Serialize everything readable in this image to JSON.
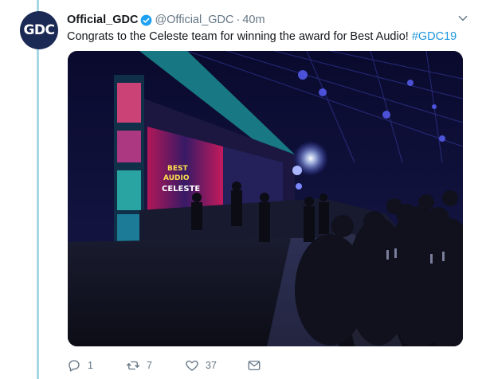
{
  "tweet": {
    "author_name": "Official_GDC",
    "handle": "@Official_GDC",
    "separator": "·",
    "time": "40m",
    "avatar_text": "GDC",
    "text_before": "Congrats to the Celeste team for winning the award for Best Audio! ",
    "hashtag": "#GDC19"
  },
  "stage_screen": {
    "line1": "BEST",
    "line2": "AUDIO",
    "line3": "CELESTE"
  },
  "actions": {
    "reply_count": "1",
    "retweet_count": "7",
    "like_count": "37"
  },
  "colors": {
    "verified": "#1da1f2",
    "hashtag": "#1b95e0",
    "thread_line": "#a6d9e3"
  }
}
